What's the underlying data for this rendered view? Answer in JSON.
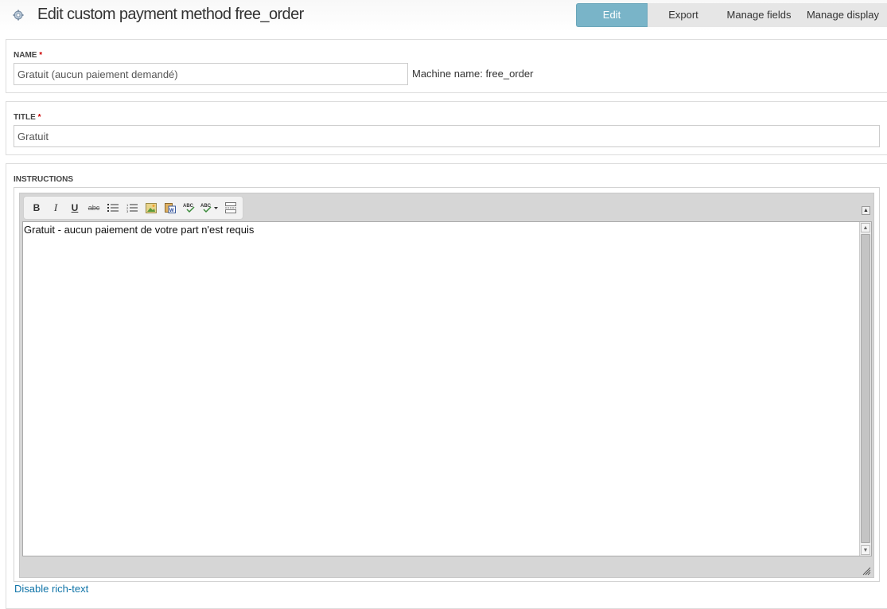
{
  "header": {
    "app_icon": "gear-icon",
    "title": "Edit custom payment method free_order"
  },
  "tabs": [
    {
      "label": "Edit",
      "active": true
    },
    {
      "label": "Export",
      "active": false
    },
    {
      "label": "Manage fields",
      "active": false
    },
    {
      "label": "Manage display",
      "active": false
    }
  ],
  "name_field": {
    "label": "NAME",
    "required_marker": "*",
    "value": "Gratuit (aucun paiement demandé)",
    "machine_name_label": "Machine name: ",
    "machine_name_value": "free_order"
  },
  "title_field": {
    "label": "TITLE",
    "required_marker": "*",
    "value": "Gratuit"
  },
  "instructions_field": {
    "label": "INSTRUCTIONS",
    "content": "Gratuit - aucun paiement de votre part n'est requis",
    "toolbar": [
      {
        "name": "bold",
        "glyph": "B"
      },
      {
        "name": "italic",
        "glyph": "I"
      },
      {
        "name": "underline",
        "glyph": "U"
      },
      {
        "name": "strikethrough",
        "glyph": "abc"
      },
      {
        "name": "bulleted-list",
        "glyph": "☰"
      },
      {
        "name": "numbered-list",
        "glyph": "☷"
      },
      {
        "name": "image",
        "glyph": "▣"
      },
      {
        "name": "paste-word",
        "glyph": "W"
      },
      {
        "name": "spellcheck",
        "glyph": "ABC"
      },
      {
        "name": "spellcheck-as-you-type",
        "glyph": "ABC▾"
      },
      {
        "name": "page-break",
        "glyph": "⎯"
      }
    ],
    "disable_link": "Disable rich-text"
  },
  "colors": {
    "active_tab": "#79b4c8",
    "link": "#0f74a8",
    "required": "#cc0000"
  }
}
